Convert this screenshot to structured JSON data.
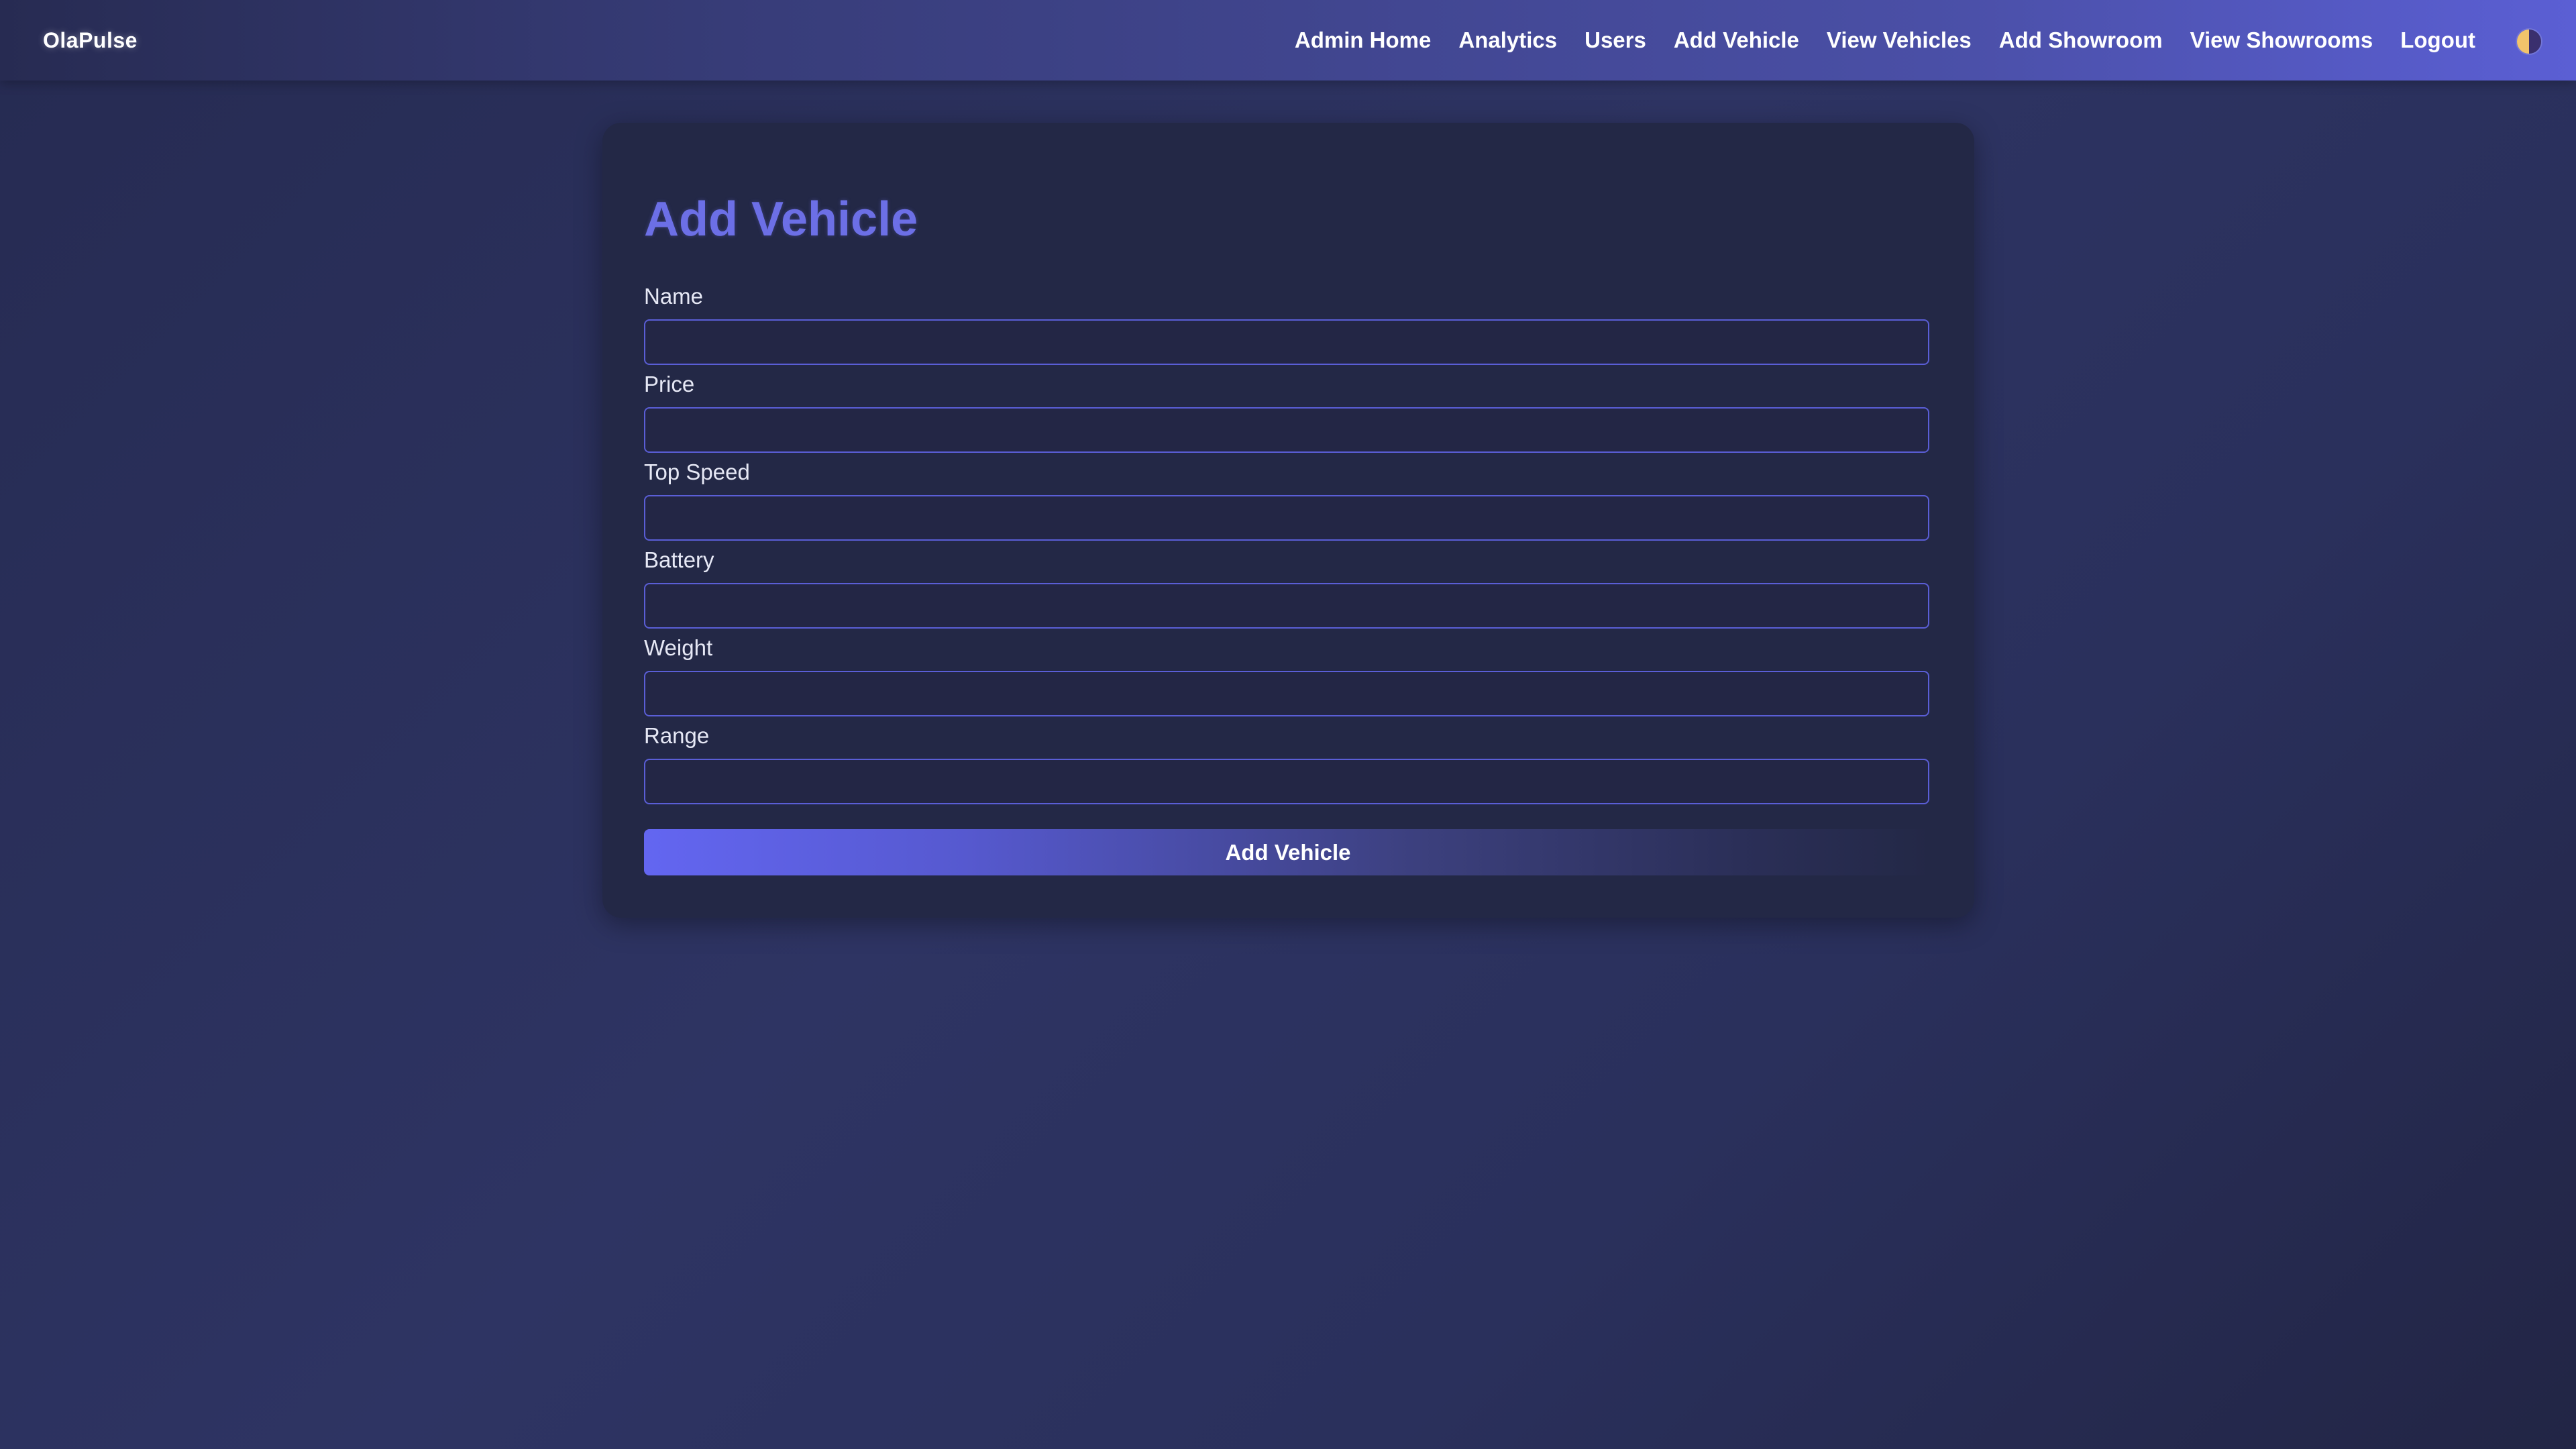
{
  "navbar": {
    "brand": "OlaPulse",
    "links": [
      {
        "label": "Admin Home"
      },
      {
        "label": "Analytics"
      },
      {
        "label": "Users"
      },
      {
        "label": "Add Vehicle"
      },
      {
        "label": "View Vehicles"
      },
      {
        "label": "Add Showroom"
      },
      {
        "label": "View Showrooms"
      },
      {
        "label": "Logout"
      }
    ],
    "theme_toggle_icon": "half-moon-theme-icon"
  },
  "form": {
    "title": "Add Vehicle",
    "fields": [
      {
        "label": "Name",
        "value": ""
      },
      {
        "label": "Price",
        "value": ""
      },
      {
        "label": "Top Speed",
        "value": ""
      },
      {
        "label": "Battery",
        "value": ""
      },
      {
        "label": "Weight",
        "value": ""
      },
      {
        "label": "Range",
        "value": ""
      }
    ],
    "submit_label": "Add Vehicle"
  },
  "colors": {
    "accent": "#6366f1",
    "title": "#6c6fe6",
    "card_bg": "#232846",
    "input_border": "#5a5ed6"
  }
}
